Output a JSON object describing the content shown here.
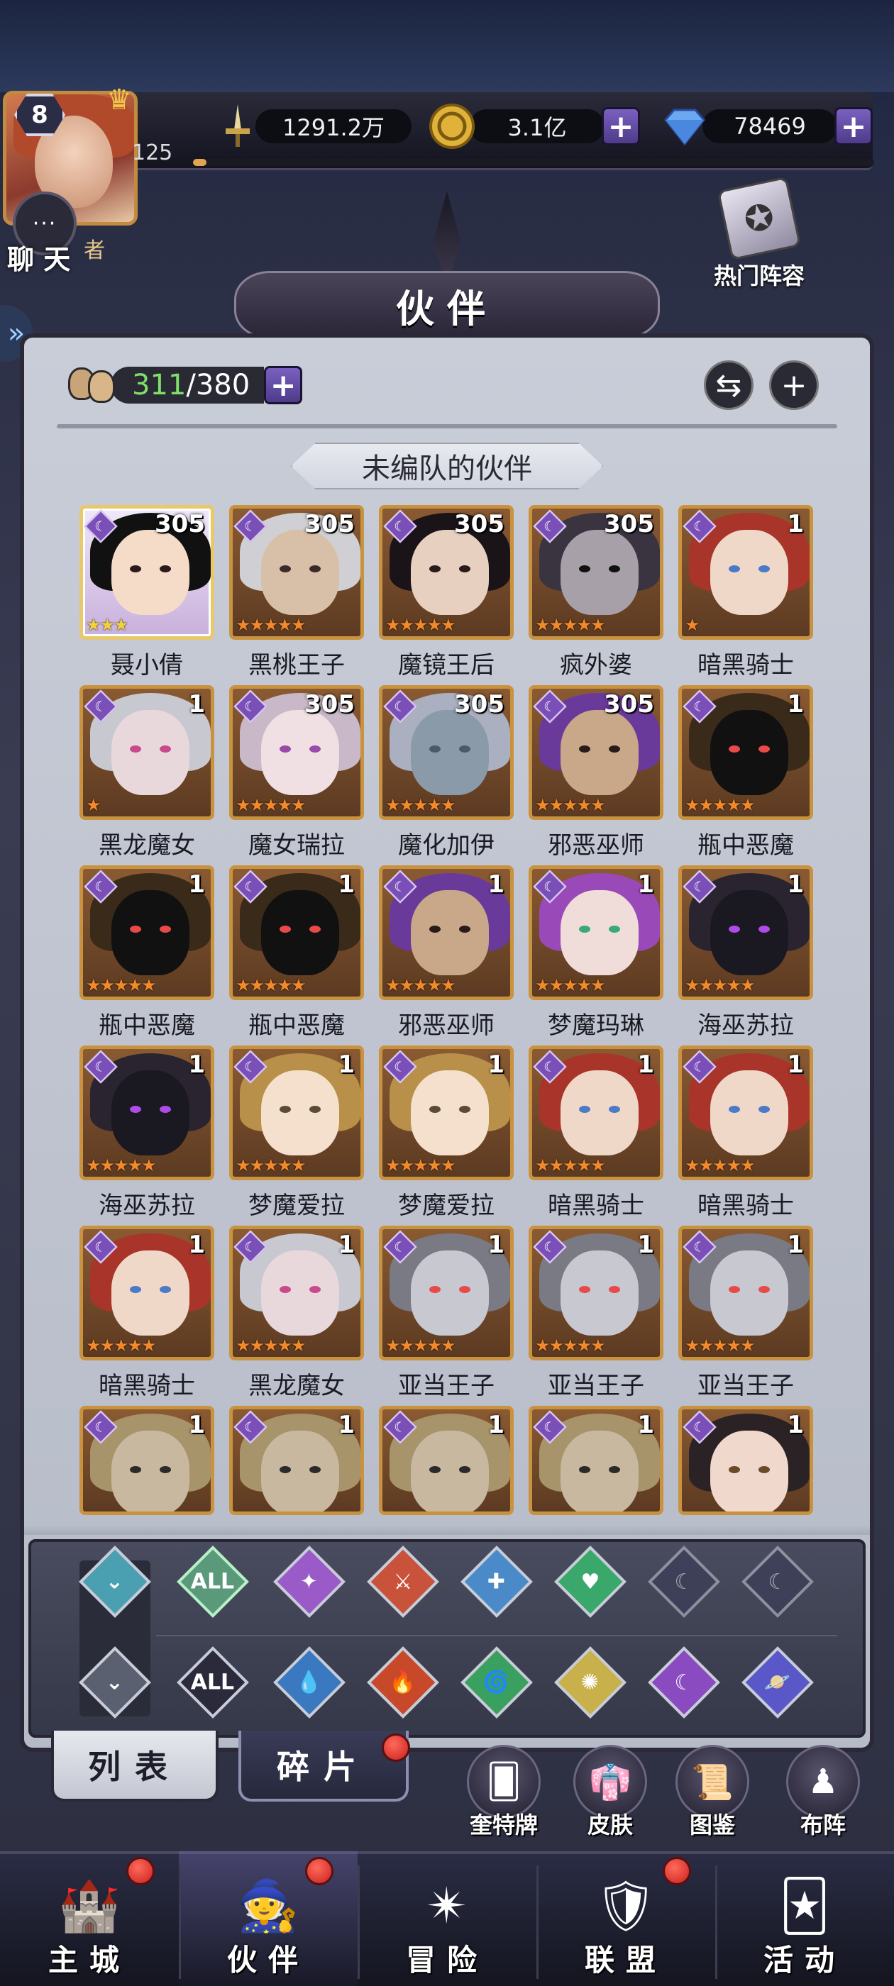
{
  "player": {
    "level": "8",
    "xp_value": "125",
    "xp_progress": 0.02,
    "portrait_label": "者"
  },
  "resources": {
    "power": "1291.2万",
    "gold": "3.1亿",
    "diamonds": "78469",
    "plus": "+"
  },
  "chat": {
    "label": "聊 天",
    "dots": "···"
  },
  "header": {
    "title": "伙伴",
    "hot_lineup": "热门阵容"
  },
  "roster": {
    "current": "311",
    "capacity": "/380",
    "plus": "+",
    "swap_icon": "⇆",
    "add_icon": "+",
    "section_title": "未编队的伙伴"
  },
  "heroes": [
    {
      "name": "聂小倩",
      "level": "305",
      "stars": "★★★",
      "star_color": "gold",
      "selected": true,
      "palette": "maiden"
    },
    {
      "name": "黑桃王子",
      "level": "305",
      "stars": "★★★★★",
      "star_color": "orange",
      "palette": "prince"
    },
    {
      "name": "魔镜王后",
      "level": "305",
      "stars": "★★★★★",
      "star_color": "orange",
      "palette": "queen"
    },
    {
      "name": "疯外婆",
      "level": "305",
      "stars": "★★★★★",
      "star_color": "orange",
      "palette": "crone"
    },
    {
      "name": "暗黑骑士",
      "level": "1",
      "stars": "★",
      "star_color": "orange",
      "palette": "redhair"
    },
    {
      "name": "黑龙魔女",
      "level": "1",
      "stars": "★",
      "star_color": "orange",
      "palette": "silver"
    },
    {
      "name": "魔女瑞拉",
      "level": "305",
      "stars": "★★★★★",
      "star_color": "orange",
      "palette": "lilac"
    },
    {
      "name": "魔化加伊",
      "level": "305",
      "stars": "★★★★★",
      "star_color": "orange",
      "palette": "masked"
    },
    {
      "name": "邪恶巫师",
      "level": "305",
      "stars": "★★★★★",
      "star_color": "orange",
      "palette": "wizard"
    },
    {
      "name": "瓶中恶魔",
      "level": "1",
      "stars": "★★★★★",
      "star_color": "orange",
      "palette": "shadow"
    },
    {
      "name": "瓶中恶魔",
      "level": "1",
      "stars": "★★★★★",
      "star_color": "orange",
      "palette": "shadow"
    },
    {
      "name": "瓶中恶魔",
      "level": "1",
      "stars": "★★★★★",
      "star_color": "orange",
      "palette": "shadow"
    },
    {
      "name": "邪恶巫师",
      "level": "1",
      "stars": "★★★★★",
      "star_color": "orange",
      "palette": "wizard"
    },
    {
      "name": "梦魔玛琳",
      "level": "1",
      "stars": "★★★★★",
      "star_color": "orange",
      "palette": "purplehair"
    },
    {
      "name": "海巫苏拉",
      "level": "1",
      "stars": "★★★★★",
      "star_color": "orange",
      "palette": "seawitch"
    },
    {
      "name": "海巫苏拉",
      "level": "1",
      "stars": "★★★★★",
      "star_color": "orange",
      "palette": "seawitch"
    },
    {
      "name": "梦魔爱拉",
      "level": "1",
      "stars": "★★★★★",
      "star_color": "orange",
      "palette": "blonde"
    },
    {
      "name": "梦魔爱拉",
      "level": "1",
      "stars": "★★★★★",
      "star_color": "orange",
      "palette": "blonde"
    },
    {
      "name": "暗黑骑士",
      "level": "1",
      "stars": "★★★★★",
      "star_color": "orange",
      "palette": "redhair"
    },
    {
      "name": "暗黑骑士",
      "level": "1",
      "stars": "★★★★★",
      "star_color": "orange",
      "palette": "redhair"
    },
    {
      "name": "暗黑骑士",
      "level": "1",
      "stars": "★★★★★",
      "star_color": "orange",
      "palette": "redhair"
    },
    {
      "name": "黑龙魔女",
      "level": "1",
      "stars": "★★★★★",
      "star_color": "orange",
      "palette": "silver"
    },
    {
      "name": "亚当王子",
      "level": "1",
      "stars": "★★★★★",
      "star_color": "orange",
      "palette": "beast"
    },
    {
      "name": "亚当王子",
      "level": "1",
      "stars": "★★★★★",
      "star_color": "orange",
      "palette": "beast"
    },
    {
      "name": "亚当王子",
      "level": "1",
      "stars": "★★★★★",
      "star_color": "orange",
      "palette": "beast"
    },
    {
      "name": "",
      "level": "1",
      "stars": "",
      "star_color": "orange",
      "palette": "mummy"
    },
    {
      "name": "",
      "level": "1",
      "stars": "",
      "star_color": "orange",
      "palette": "mummy"
    },
    {
      "name": "",
      "level": "1",
      "stars": "",
      "star_color": "orange",
      "palette": "mummy"
    },
    {
      "name": "",
      "level": "1",
      "stars": "",
      "star_color": "orange",
      "palette": "mummy"
    },
    {
      "name": "",
      "level": "1",
      "stars": "",
      "star_color": "orange",
      "palette": "darkhair"
    }
  ],
  "filters": {
    "row1": [
      {
        "icon": "chevron-filter-icon",
        "glyph": "⌄",
        "label": "",
        "color": "#4a9fb0"
      },
      {
        "icon": "all-class-icon",
        "glyph": "",
        "label": "ALL",
        "color": "#5a9a7a"
      },
      {
        "icon": "mage-class-icon",
        "glyph": "✦",
        "label": "",
        "color": "#9a5ac8"
      },
      {
        "icon": "warrior-class-icon",
        "glyph": "⚔",
        "label": "",
        "color": "#c8523a"
      },
      {
        "icon": "support-class-icon",
        "glyph": "✚",
        "label": "",
        "color": "#4a8ac8"
      },
      {
        "icon": "healer-class-icon",
        "glyph": "♥",
        "label": "",
        "color": "#3aa86a"
      },
      {
        "icon": "assassin-class-icon",
        "glyph": "☾",
        "label": "",
        "color": "#3a3a58"
      },
      {
        "icon": "tank-class-icon",
        "glyph": "☾",
        "label": "",
        "color": "#3a3a58"
      }
    ],
    "row2": [
      {
        "icon": "chevron-filter-icon",
        "glyph": "⌄",
        "label": "",
        "color": "#5a6070"
      },
      {
        "icon": "all-element-icon",
        "glyph": "",
        "label": "ALL",
        "color": "#2a2a3a"
      },
      {
        "icon": "water-element-icon",
        "glyph": "💧",
        "label": "",
        "color": "#3a78c0"
      },
      {
        "icon": "fire-element-icon",
        "glyph": "🔥",
        "label": "",
        "color": "#c8482a"
      },
      {
        "icon": "wind-element-icon",
        "glyph": "🌀",
        "label": "",
        "color": "#3aa060"
      },
      {
        "icon": "light-element-icon",
        "glyph": "✺",
        "label": "",
        "color": "#c8b04a"
      },
      {
        "icon": "moon-element-icon",
        "glyph": "☾",
        "label": "",
        "color": "#8a4ac0"
      },
      {
        "icon": "cosmic-element-icon",
        "glyph": "🪐",
        "label": "",
        "color": "#5a58c8"
      }
    ]
  },
  "tabs": [
    {
      "label": "列表",
      "active": true
    },
    {
      "label": "碎片",
      "active": false
    }
  ],
  "quick_actions": [
    {
      "label": "奎特牌",
      "icon": "card-deck-icon",
      "glyph": "🂠"
    },
    {
      "label": "皮肤",
      "icon": "skin-icon",
      "glyph": "👘"
    },
    {
      "label": "图鉴",
      "icon": "codex-icon",
      "glyph": "📜"
    },
    {
      "label": "布阵",
      "icon": "formation-icon",
      "glyph": "♟"
    }
  ],
  "nav": [
    {
      "label": "主城",
      "icon": "castle-icon",
      "glyph": "🏰",
      "badge": true
    },
    {
      "label": "伙伴",
      "icon": "witch-hat-icon",
      "glyph": "🧙",
      "badge": true,
      "active": true
    },
    {
      "label": "冒险",
      "icon": "portal-icon",
      "glyph": "✴",
      "badge": false
    },
    {
      "label": "联盟",
      "icon": "shield-icon",
      "glyph": "🛡",
      "badge": true
    },
    {
      "label": "活动",
      "icon": "cards-icon",
      "glyph": "🃏",
      "badge": false
    }
  ]
}
